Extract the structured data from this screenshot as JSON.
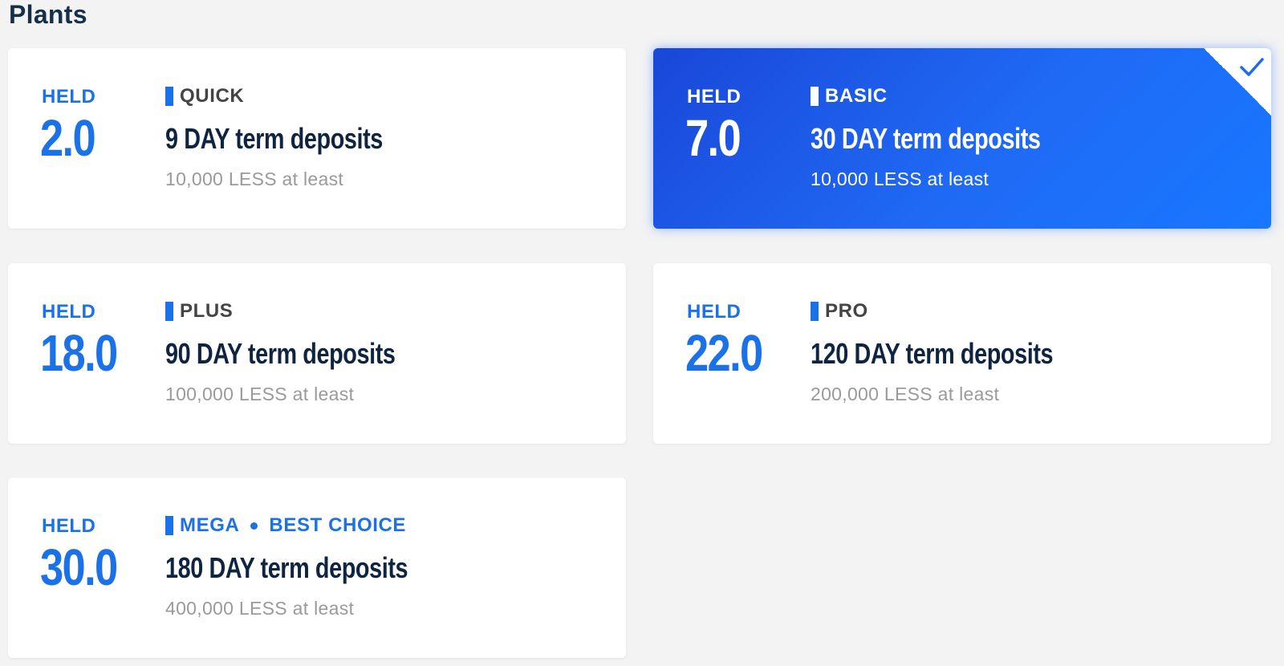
{
  "page": {
    "title": "Plants"
  },
  "colors": {
    "accent": "#1b72e8",
    "selected_bg": "#1f6af5",
    "background": "#f3f3f3",
    "heading": "#0f2440",
    "muted": "#9a9a9a"
  },
  "plans": [
    {
      "held_label": "HELD",
      "held_value": "2.0",
      "tier": "QUICK",
      "term": "9 DAY term deposits",
      "minimum": "10,000 LESS at least",
      "selected": false
    },
    {
      "held_label": "HELD",
      "held_value": "7.0",
      "tier": "BASIC",
      "term": "30 DAY term deposits",
      "minimum": "10,000 LESS at least",
      "selected": true,
      "check_icon": "checkmark-icon"
    },
    {
      "held_label": "HELD",
      "held_value": "18.0",
      "tier": "PLUS",
      "term": "90 DAY term deposits",
      "minimum": "100,000 LESS at least",
      "selected": false
    },
    {
      "held_label": "HELD",
      "held_value": "22.0",
      "tier": "PRO",
      "term": "120 DAY term deposits",
      "minimum": "200,000 LESS at least",
      "selected": false
    },
    {
      "held_label": "HELD",
      "held_value": "30.0",
      "tier": "MEGA",
      "tier_tag": "BEST CHOICE",
      "term": "180 DAY term deposits",
      "minimum": "400,000 LESS at least",
      "selected": false
    }
  ]
}
